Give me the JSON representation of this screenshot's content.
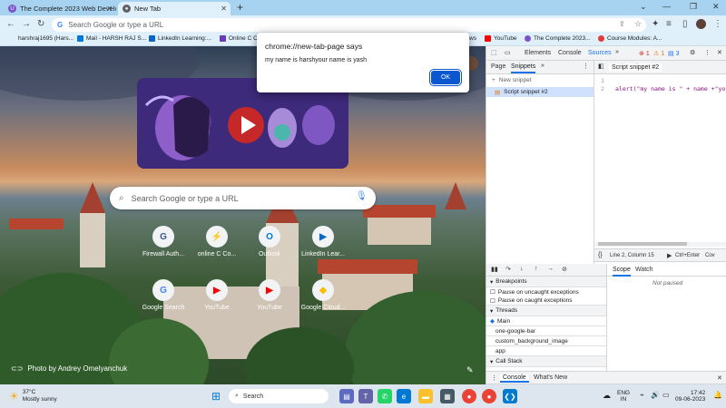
{
  "browser": {
    "tabs": [
      {
        "label": "The Complete 2023 Web Develo",
        "active": false
      },
      {
        "label": "New Tab",
        "active": true
      }
    ],
    "omnibox_placeholder": "Search Google or type a URL",
    "bookmarks": [
      {
        "label": "harshraj1695 (Hars..."
      },
      {
        "label": "Mail - HARSH RAJ S..."
      },
      {
        "label": "LinkedIn Learning:..."
      },
      {
        "label": "Online C C"
      },
      {
        "label": "ws"
      },
      {
        "label": "YouTube"
      },
      {
        "label": "The Complete 2023..."
      },
      {
        "label": "Course Modules: A..."
      }
    ]
  },
  "newtab": {
    "search_placeholder": "Search Google or type a URL",
    "shortcuts": [
      {
        "label": "Firewall Auth...",
        "icon": "G"
      },
      {
        "label": "online C Co...",
        "icon": "⚡"
      },
      {
        "label": "Outlook",
        "icon": "O"
      },
      {
        "label": "LinkedIn Lear...",
        "icon": "▶"
      },
      {
        "label": "Google Search",
        "icon": "G"
      },
      {
        "label": "YouTube",
        "icon": "▶"
      },
      {
        "label": "YouTube",
        "icon": "▶"
      },
      {
        "label": "Google Cloud...",
        "icon": "◆"
      }
    ],
    "photo_credit": "Photo by Andrey Omelyanchuk"
  },
  "dialog": {
    "title": "chrome://new-tab-page says",
    "message": "my name is harshyour name is yash",
    "ok_label": "OK"
  },
  "devtools": {
    "main_tabs": [
      "Elements",
      "Console",
      "Sources"
    ],
    "badges": {
      "errors": "1",
      "warnings": "1",
      "info": "3"
    },
    "nav_tabs": [
      "Page",
      "Snippets"
    ],
    "new_snippet": "New snippet",
    "snippet_item": "Script snippet #2",
    "editor_tab": "Script snippet #2",
    "line_numbers": [
      "1",
      "2"
    ],
    "code_line": "alert(\"my name is \" + name +\"your na",
    "status": "Line 2, Column 15",
    "run_hint": "Ctrl+Enter",
    "coverage": "Cov",
    "debugger_tabs": [
      "Scope",
      "Watch"
    ],
    "not_paused": "Not paused",
    "breakpoints_header": "Breakpoints",
    "pause_uncaught": "Pause on uncaught exceptions",
    "pause_caught": "Pause on caught exceptions",
    "threads_header": "Threads",
    "threads": [
      "Main",
      "one-google-bar",
      "custom_background_image",
      "app"
    ],
    "callstack_header": "Call Stack",
    "drawer_tabs": [
      "Console",
      "What's New"
    ]
  },
  "taskbar": {
    "weather_temp": "37°C",
    "weather_desc": "Mostly sunny",
    "search_label": "Search",
    "lang1": "ENG",
    "lang2": "IN",
    "time": "17:42",
    "date": "09-06-2023"
  },
  "colors": {
    "accent": "#1a73e8",
    "dialog_button": "#0b57d0",
    "titlebar": "#a7d3f1",
    "toolbar": "#dff0fb"
  }
}
